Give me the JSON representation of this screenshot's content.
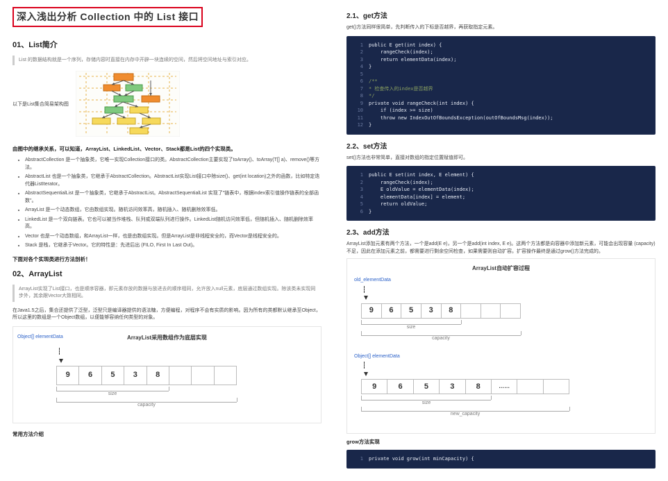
{
  "left": {
    "main_title": "深入浅出分析 Collection 中的 List 接口",
    "s01_title": "01、List简介",
    "s01_quote": "List 的数据结构就是一个序列，存储内容时直接在内存中开辟一块连续的空间，然后将空间地址与索引对应。",
    "s01_caption": "以下是List集合简易架构图",
    "s01_inherit": "由图中的继承关系，可以知道，ArrayList、LinkedList、Vector、Stack都是List的四个实现类。",
    "bullets": [
      "AbstractCollection 是一个抽象类，它唯一实现Collection接口的类。AbstractCollection主要实现了toArray()、toArray(T[] a)、remove()等方法。",
      "AbstractList 也是一个抽象类，它继承于AbstractCollection。AbstractList实现List接口中除size()、get(int location)之外的函数，比如特定迭代器ListIterator。",
      "AbstractSequentialList 是一个抽象类，它继承于AbstractList。AbstractSequentialList 实现了\"链表中，根据index索引值操作链表的全部函数\"。",
      "ArrayList 是一个动态数组，它由数组实现。随机访问效率高，随机插入、随机删除效率低。",
      "LinkedList 是一个双向链表。它也可以被当作堆栈、队列或双端队列进行操作。LinkedList随机访问效率低，但随机插入、随机删除效率高。",
      "Vector 也是一个动态数组，和ArrayList一样，也是由数组实现。但是ArrayList是非线程安全的，而Vector是线程安全的。",
      "Stack 是栈，它继承于Vector。它的特性是：先进后出 (FILO, First In Last Out)。"
    ],
    "s01_tail": "下面对各个实现类进行方法剖析！",
    "s02_title": "02、ArrayList",
    "s02_quote": "ArrayList实现了List接口，也是顺序容器，即元素存放的数据与放进去的顺序相同，允许放入null元素，底层通过数组实现。除该类未实现同步外，其余跟Vector大致相同。",
    "s02_p1": "在Java1.5之后，集合还提供了泛型，泛型只是编译器提供的语法糖，方便编程，对程序不会有实质的影响。因为所有的类都默认继承至Object，所以这里的数组是一个Object数组，以便能够容纳任何类型的对象。",
    "diag2_label": "Object[] elementData",
    "diag2_title": "ArrayList采用数组作为底层实现",
    "diag2_cells": [
      "9",
      "6",
      "5",
      "3",
      "8",
      "",
      "",
      ""
    ],
    "diag2_size": "size",
    "diag2_cap": "capacity",
    "s02_tail": "常用方法介绍"
  },
  "right": {
    "s21_title": "2.1、get方法",
    "s21_p": "get()方法同样很简单，先判断传入的下标是否越界，再获取指定元素。",
    "code1": [
      "public E get(int index) {",
      "    rangeCheck(index);",
      "    return elementData(index);",
      "}",
      "",
      "/**",
      "* 检查传入的index是否越界",
      "*/",
      "private void rangeCheck(int index) {",
      "    if (index >= size)",
      "    throw new IndexOutOfBoundsException(outOfBoundsMsg(index));",
      "}"
    ],
    "s22_title": "2.2、set方法",
    "s22_p": "set()方法也非常简单，直接对数组的指定位置赋值即可。",
    "code2": [
      "public E set(int index, E element) {",
      "    rangeCheck(index);",
      "    E oldValue = elementData(index);",
      "    elementData[index] = element;",
      "    return oldValue;",
      "}"
    ],
    "s23_title": "2.3、add方法",
    "s23_p": "ArrayList添加元素有两个方法，一个是add(E e)，另一个是add(int index, E e)。这两个方法都是向容器中添加新元素，可能会出现容量 (capacity) 不足，因此在添加元素之前，都需要进行剩余空间检查，如果需要则自动扩容。扩容操作最终是通过grow()方法完成的。",
    "grow_title": "ArrayList自动扩容过程",
    "grow_hdr1": "old_elementData",
    "grow_hdr2": "Object[] elementData",
    "grow_cells1": [
      "9",
      "6",
      "5",
      "3",
      "8"
    ],
    "grow_cells2": [
      "9",
      "6",
      "5",
      "3",
      "8",
      "……",
      "",
      ""
    ],
    "grow_size": "size",
    "grow_cap": "capacity",
    "grow_newcap": "new_capacity",
    "grow_tail": "grow方法实现",
    "code3_line": "private void grow(int minCapacity) {"
  }
}
